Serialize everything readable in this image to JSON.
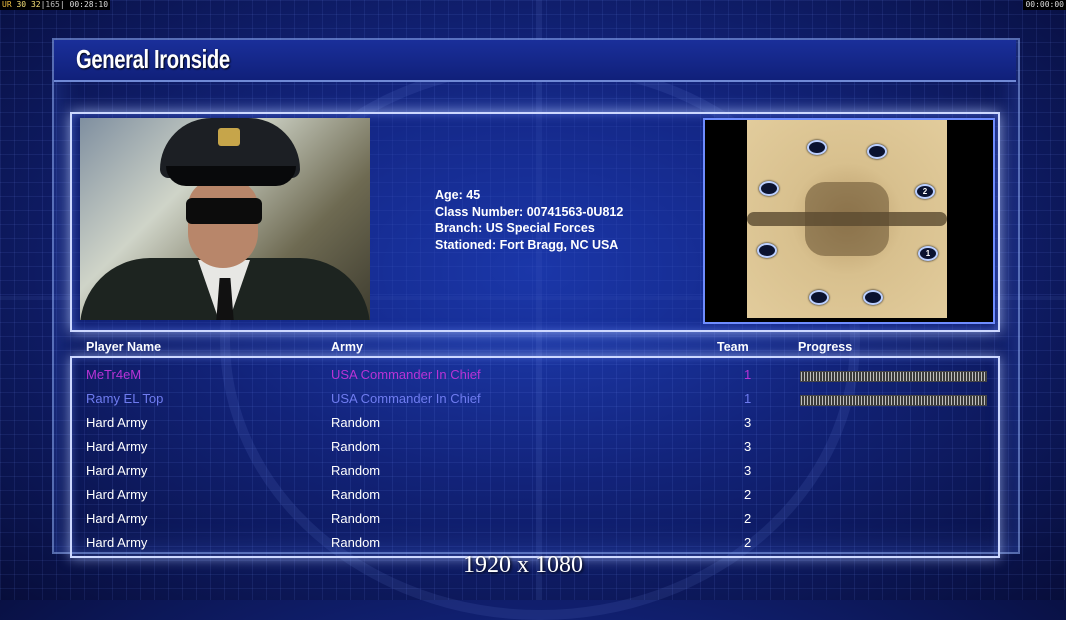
{
  "hud": {
    "left_codes": [
      "UR",
      "30",
      "32",
      "165"
    ],
    "left_time": "00:28:10",
    "right_time": "00:00:00"
  },
  "title": "General Ironside",
  "portrait_alt": "General Ironside portrait",
  "bio": {
    "age": "Age: 45",
    "class_number": "Class Number: 00741563-0U812",
    "branch": "Branch: US Special Forces",
    "stationed": "Stationed: Fort Bragg, NC USA"
  },
  "map": {
    "spawn_labels": [
      "",
      "",
      "",
      "2",
      "",
      "1",
      "",
      ""
    ]
  },
  "roster": {
    "headers": {
      "name": "Player Name",
      "army": "Army",
      "team": "Team",
      "progress": "Progress"
    },
    "rows": [
      {
        "name": "MeTr4eM",
        "army": "USA Commander In Chief",
        "team": "1",
        "color": "#b833d6",
        "progress": 1
      },
      {
        "name": "Ramy EL Top",
        "army": "USA Commander In Chief",
        "team": "1",
        "color": "#6f7cf0",
        "progress": 1
      },
      {
        "name": "Hard Army",
        "army": "Random",
        "team": "3",
        "color": "#ffffff",
        "progress": null
      },
      {
        "name": "Hard Army",
        "army": "Random",
        "team": "3",
        "color": "#ffffff",
        "progress": null
      },
      {
        "name": "Hard Army",
        "army": "Random",
        "team": "3",
        "color": "#ffffff",
        "progress": null
      },
      {
        "name": "Hard Army",
        "army": "Random",
        "team": "2",
        "color": "#ffffff",
        "progress": null
      },
      {
        "name": "Hard Army",
        "army": "Random",
        "team": "2",
        "color": "#ffffff",
        "progress": null
      },
      {
        "name": "Hard Army",
        "army": "Random",
        "team": "2",
        "color": "#ffffff",
        "progress": null
      }
    ]
  },
  "resolution": "1920 x 1080"
}
